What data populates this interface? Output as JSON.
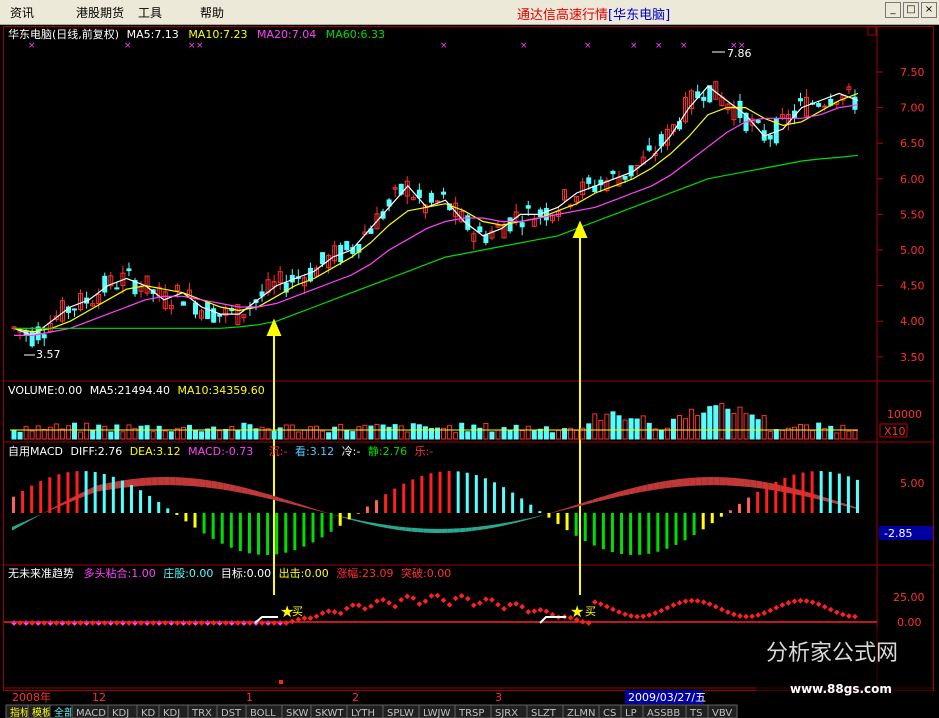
{
  "menu": [
    "资讯",
    "港股期货",
    "工具",
    "帮助"
  ],
  "app_title": "通达信高速行情",
  "app_title_brand": "[华东电脑]",
  "window_buttons": [
    "_",
    "□",
    "×"
  ],
  "main_panel": {
    "title": "华东电脑(日线,前复权)",
    "ma5": "MA5:7.13",
    "ma10": "MA10:7.23",
    "ma20": "MA20:7.04",
    "ma60": "MA60:6.33",
    "y_ticks": [
      "7.50",
      "7.00",
      "6.50",
      "6.00",
      "5.50",
      "5.00",
      "4.50",
      "4.00",
      "3.50"
    ],
    "high_label": "7.86",
    "low_label": "3.57"
  },
  "volume_panel": {
    "volume": "VOLUME:0.00",
    "ma5": "MA5:21494.40",
    "ma10": "MA10:34359.60",
    "y_tick": "10000",
    "unit": "X10"
  },
  "macd_panel": {
    "name": "自用MACD",
    "diff": "DIFF:2.76",
    "dea": "DEA:3.12",
    "macd": "MACD:-0.73",
    "sink": "沉:-",
    "look": "看:3.12",
    "cold": "冷:-",
    "calm": "静:2.76",
    "joy": "乐:-",
    "y_tick": "5.00",
    "current_value": "-2.85"
  },
  "trend_panel": {
    "name": "无未来准趋势",
    "bull": "多头粘合:1.00",
    "dealer": "庄股:0.00",
    "target": "目标:0.00",
    "exit": "出击:0.00",
    "gain": "涨幅:23.09",
    "breakout": "突破:0.00",
    "y_ticks": [
      "25.00",
      "0.00"
    ],
    "buy_label": "买"
  },
  "time_axis": {
    "year": "2008年",
    "months": [
      "12",
      "1",
      "2",
      "3"
    ],
    "current_date": "2009/03/27/五"
  },
  "bottom_tabs": [
    "指标",
    "模板",
    "全部",
    "MACD",
    "KDJ",
    "KD",
    "KDJ",
    "TRX",
    "DST",
    "BOLL",
    "SKW",
    "SKWT",
    "LYTH",
    "SPLW",
    "LWJW",
    "TRSP",
    "SJRX",
    "SLZT",
    "ZLMN",
    "CS",
    "LP",
    "ASSBB",
    "TS",
    "VBV"
  ],
  "watermark": {
    "name": "分析家公式网",
    "url": "www.88gs.com"
  },
  "colors": {
    "ma5": "#ffffff",
    "ma10": "#ffff00",
    "ma20": "#ff44ff",
    "ma60": "#00dd00",
    "up": "#ff3030",
    "down": "#54ffff",
    "axis": "#c00000",
    "arrow": "#ffff00"
  },
  "chart_data": {
    "type": "line",
    "title": "华东电脑(日线,前复权)",
    "ylim": [
      3.3,
      7.9
    ],
    "series": [
      {
        "name": "MA5",
        "values": [
          3.9,
          3.8,
          4.0,
          4.2,
          4.3,
          4.5,
          4.6,
          4.5,
          4.3,
          4.4,
          4.2,
          4.1,
          4.1,
          4.3,
          4.5,
          4.6,
          4.7,
          4.9,
          5.0,
          5.3,
          5.6,
          5.9,
          5.6,
          5.7,
          5.4,
          5.2,
          5.3,
          5.5,
          5.5,
          5.6,
          5.8,
          5.9,
          6.0,
          6.1,
          6.3,
          6.6,
          7.0,
          7.3,
          7.1,
          6.9,
          6.6,
          6.7,
          7.0,
          7.1,
          7.2,
          7.1
        ]
      },
      {
        "name": "MA10",
        "values": [
          3.9,
          3.85,
          3.9,
          4.0,
          4.15,
          4.3,
          4.45,
          4.5,
          4.45,
          4.4,
          4.3,
          4.2,
          4.15,
          4.2,
          4.35,
          4.5,
          4.6,
          4.75,
          4.9,
          5.1,
          5.35,
          5.55,
          5.6,
          5.65,
          5.55,
          5.4,
          5.35,
          5.4,
          5.45,
          5.55,
          5.65,
          5.8,
          5.9,
          6.0,
          6.15,
          6.35,
          6.6,
          6.9,
          7.0,
          7.0,
          6.85,
          6.75,
          6.8,
          6.95,
          7.1,
          7.2
        ]
      },
      {
        "name": "MA20",
        "values": [
          3.8,
          3.8,
          3.85,
          3.9,
          4.0,
          4.1,
          4.2,
          4.3,
          4.35,
          4.35,
          4.3,
          4.25,
          4.2,
          4.2,
          4.25,
          4.35,
          4.45,
          4.55,
          4.65,
          4.8,
          5.0,
          5.15,
          5.3,
          5.4,
          5.45,
          5.45,
          5.4,
          5.4,
          5.45,
          5.5,
          5.55,
          5.6,
          5.7,
          5.8,
          5.9,
          6.05,
          6.25,
          6.45,
          6.65,
          6.8,
          6.85,
          6.85,
          6.85,
          6.9,
          7.0,
          7.04
        ]
      },
      {
        "name": "MA60",
        "values": [
          3.9,
          3.9,
          3.9,
          3.9,
          3.9,
          3.9,
          3.9,
          3.9,
          3.9,
          3.9,
          3.9,
          3.9,
          3.92,
          3.95,
          4.0,
          4.1,
          4.2,
          4.3,
          4.4,
          4.5,
          4.6,
          4.7,
          4.8,
          4.9,
          4.95,
          5.0,
          5.05,
          5.1,
          5.15,
          5.2,
          5.3,
          5.4,
          5.5,
          5.6,
          5.7,
          5.8,
          5.9,
          6.0,
          6.05,
          6.1,
          6.15,
          6.2,
          6.25,
          6.28,
          6.3,
          6.33
        ]
      }
    ]
  }
}
